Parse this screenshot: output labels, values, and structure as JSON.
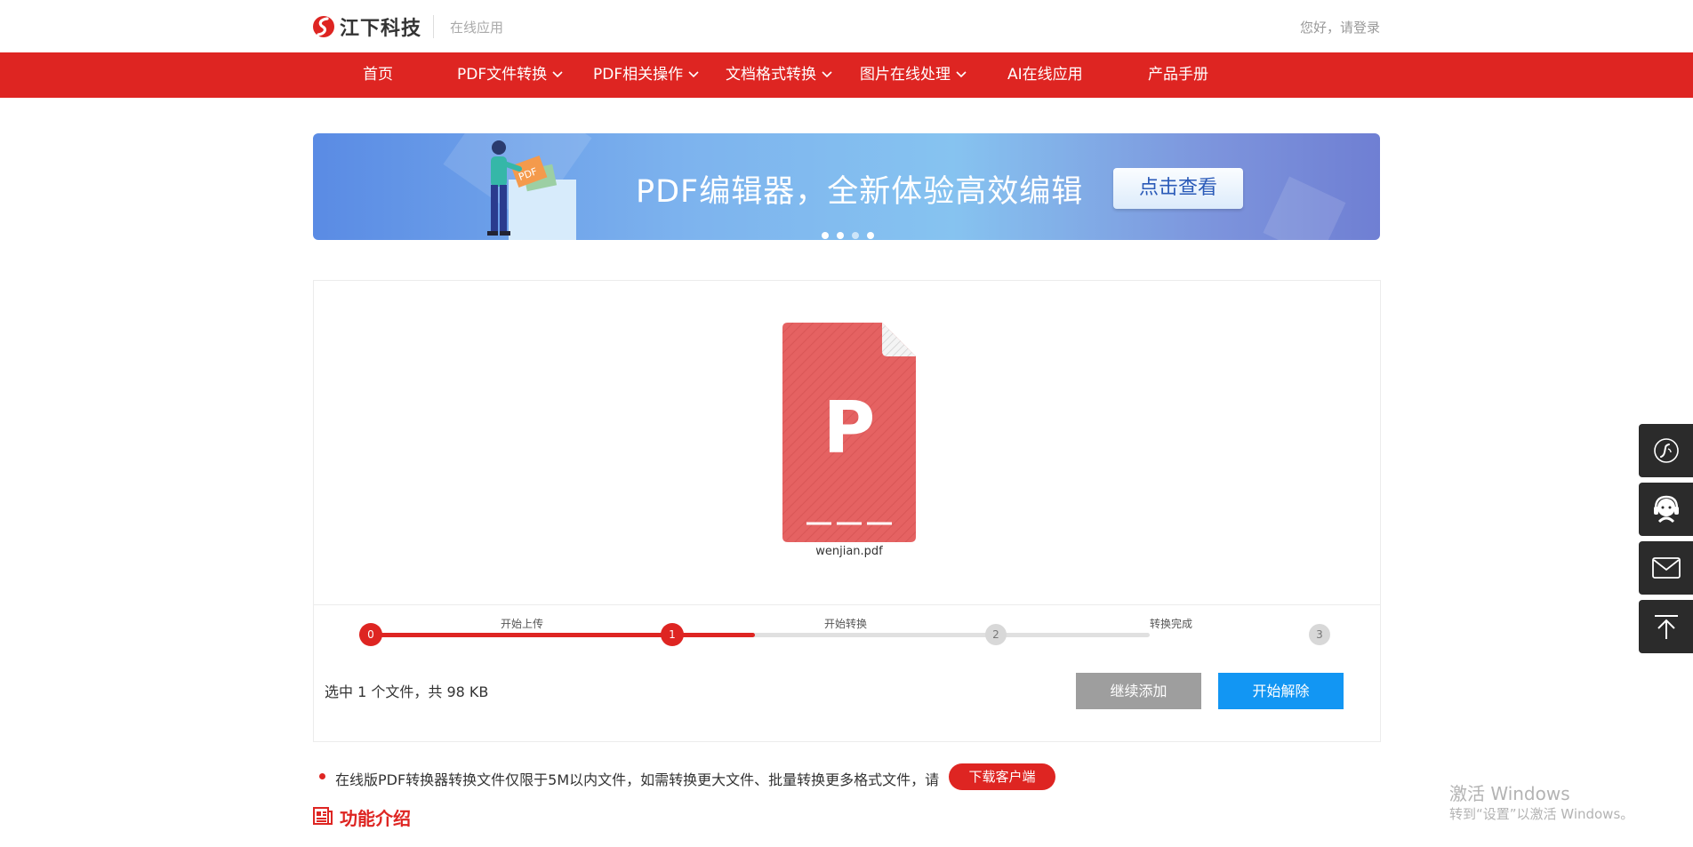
{
  "header": {
    "brand": "江下科技",
    "subtitle": "在线应用",
    "login_text": "您好，请登录"
  },
  "nav": {
    "items": [
      {
        "label": "首页",
        "dropdown": false
      },
      {
        "label": "PDF文件转换",
        "dropdown": true
      },
      {
        "label": "PDF相关操作",
        "dropdown": true
      },
      {
        "label": "文档格式转换",
        "dropdown": true
      },
      {
        "label": "图片在线处理",
        "dropdown": true
      },
      {
        "label": "AI在线应用",
        "dropdown": false
      },
      {
        "label": "产品手册",
        "dropdown": false
      }
    ]
  },
  "banner": {
    "title": "PDF编辑器，全新体验高效编辑",
    "button_label": "点击查看",
    "slide_count": 4,
    "active_slide": 1
  },
  "upload": {
    "file_letter": "P",
    "file_name": "wenjian.pdf",
    "steps": [
      {
        "number": "0",
        "label": "开始上传",
        "state": "done"
      },
      {
        "number": "1",
        "label": "开始转换",
        "state": "active"
      },
      {
        "number": "2",
        "label": "转换完成",
        "state": "pending"
      },
      {
        "number": "3",
        "label": "",
        "state": "pending"
      }
    ],
    "progress_fraction": 0.5,
    "selected_info": "选中 1 个文件，共 98 KB",
    "continue_button": "继续添加",
    "start_button": "开始解除"
  },
  "notice": {
    "text": "在线版PDF转换器转换文件仅限于5M以内文件，如需转换更大文件、批量转换更多格式文件，请",
    "download_button": "下载客户端"
  },
  "section": {
    "title": "功能介绍"
  },
  "side_tools": [
    "phone-icon",
    "customer-service-icon",
    "mail-icon",
    "back-to-top-icon"
  ],
  "watermark": {
    "line1": "激活 Windows",
    "line2": "转到“设置”以激活 Windows。"
  },
  "colors": {
    "brand_red": "#de2522",
    "primary_blue": "#1296f3",
    "gray_button": "#9e9e9e"
  }
}
